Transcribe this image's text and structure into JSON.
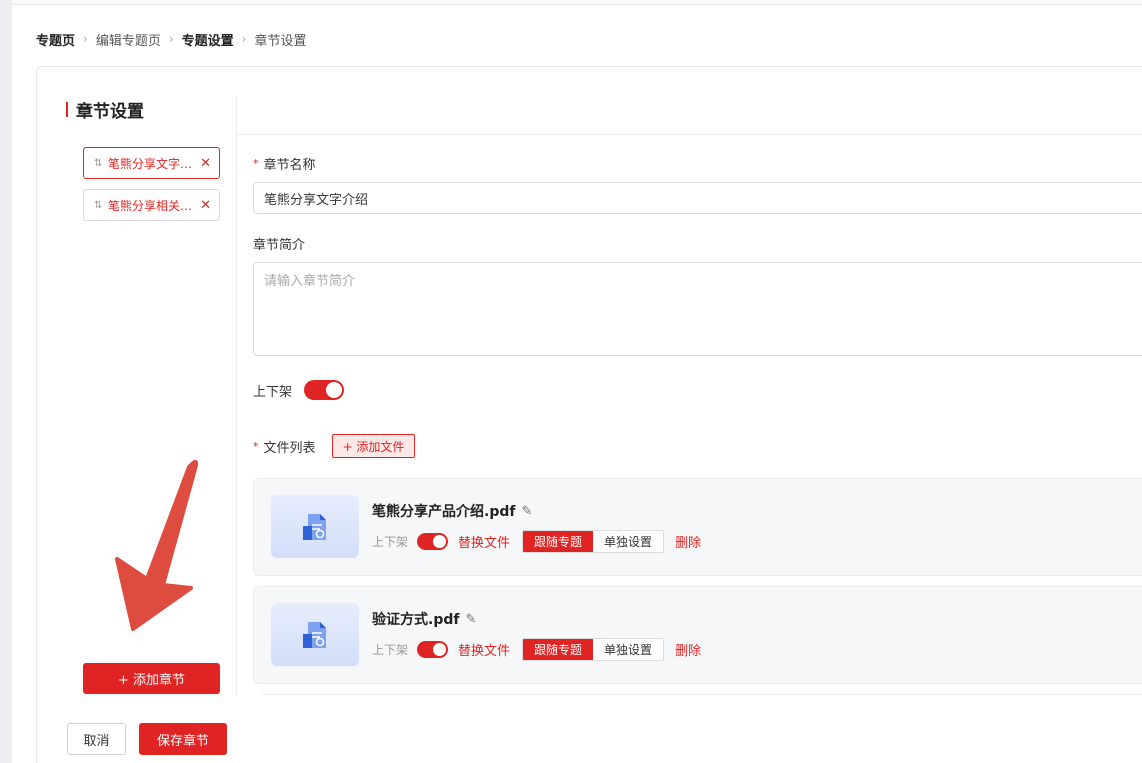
{
  "breadcrumb": [
    "专题页",
    "编辑专题页",
    "专题设置",
    "章节设置"
  ],
  "section_title": "章节设置",
  "chapters": [
    {
      "label": "笔熊分享文字介绍",
      "active": true
    },
    {
      "label": "笔熊分享相关视频",
      "active": false
    }
  ],
  "add_chapter_label": "+ 添加章节",
  "form": {
    "name_label": "章节名称",
    "name_value": "笔熊分享文字介绍",
    "intro_label": "章节简介",
    "intro_placeholder": "请输入章节简介",
    "shelf_label": "上下架",
    "shelf_on": true,
    "files_label": "文件列表",
    "add_file_label": "+ 添加文件"
  },
  "files": [
    {
      "name": "笔熊分享产品介绍.pdf",
      "shelf_label": "上下架",
      "shelf_on": true,
      "replace_label": "替换文件",
      "follow_label": "跟随专题",
      "single_label": "单独设置",
      "delete_label": "删除"
    },
    {
      "name": "验证方式.pdf",
      "shelf_label": "上下架",
      "shelf_on": true,
      "replace_label": "替换文件",
      "follow_label": "跟随专题",
      "single_label": "单独设置",
      "delete_label": "删除"
    }
  ],
  "footer": {
    "cancel_label": "取消",
    "save_label": "保存章节"
  },
  "colors": {
    "accent": "#e02424",
    "annotation_arrow": "#de4b3f"
  },
  "icons": {
    "drag": "drag-handle-icon",
    "remove": "close-icon",
    "edit": "pencil-icon",
    "file": "document-icon",
    "breadcrumb_separator": "chevron-right-icon"
  }
}
